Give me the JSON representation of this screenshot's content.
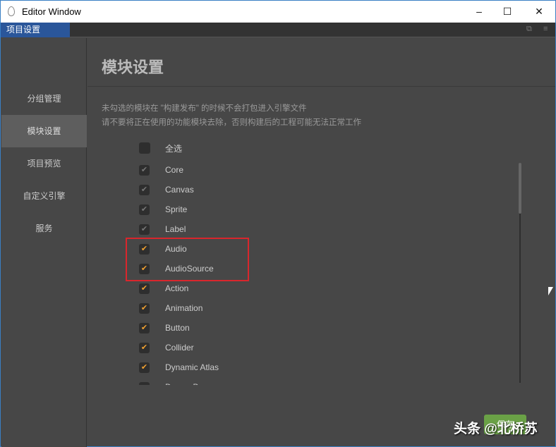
{
  "window": {
    "title": "Editor Window",
    "minimize": "–",
    "maximize": "☐",
    "close": "✕"
  },
  "tab": {
    "label": "项目设置",
    "popout_icon": "⧉",
    "menu_icon": "≡"
  },
  "sidebar": {
    "items": [
      {
        "label": "分组管理"
      },
      {
        "label": "模块设置",
        "active": true
      },
      {
        "label": "项目预览"
      },
      {
        "label": "自定义引擎"
      },
      {
        "label": "服务"
      }
    ]
  },
  "main": {
    "title": "模块设置",
    "desc1": "未勾选的模块在 \"构建发布\" 的时候不会打包进入引擎文件",
    "desc2": "请不要将正在使用的功能模块去除，否则构建后的工程可能无法正常工作",
    "select_all": "全选",
    "check_mark": "✔",
    "modules": [
      {
        "label": "Core",
        "checked": true,
        "locked": true
      },
      {
        "label": "Canvas",
        "checked": true,
        "locked": true
      },
      {
        "label": "Sprite",
        "checked": true,
        "locked": true
      },
      {
        "label": "Label",
        "checked": true,
        "locked": true
      },
      {
        "label": "Audio",
        "checked": true
      },
      {
        "label": "AudioSource",
        "checked": true
      },
      {
        "label": "Action",
        "checked": true
      },
      {
        "label": "Animation",
        "checked": true
      },
      {
        "label": "Button",
        "checked": true
      },
      {
        "label": "Collider",
        "checked": true
      },
      {
        "label": "Dynamic Atlas",
        "checked": true
      },
      {
        "label": "DragonBones",
        "checked": false
      }
    ],
    "save_label": "保存"
  },
  "colors": {
    "accent": "#f0a030",
    "tab": "#2a569a",
    "save": "#6aa146",
    "highlight": "#d9262c"
  },
  "watermark": "头条 @北桥苏"
}
